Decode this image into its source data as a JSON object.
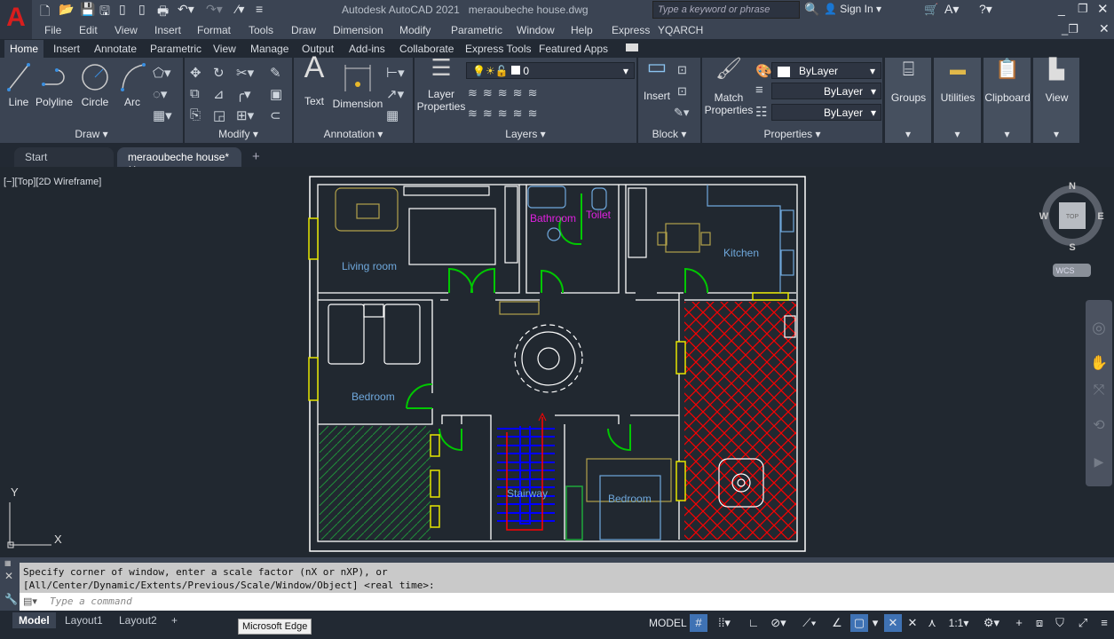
{
  "app": {
    "logo": "A",
    "title": "Autodesk AutoCAD 2021",
    "file": "meraoubeche house.dwg",
    "search_placeholder": "Type a keyword or phrase",
    "sign_in": "Sign In"
  },
  "menu": [
    "File",
    "Edit",
    "View",
    "Insert",
    "Format",
    "Tools",
    "Draw",
    "Dimension",
    "Modify",
    "Parametric",
    "Window",
    "Help",
    "Express",
    "YQARCH"
  ],
  "ribbon_tabs": [
    "Home",
    "Insert",
    "Annotate",
    "Parametric",
    "View",
    "Manage",
    "Output",
    "Add-ins",
    "Collaborate",
    "Express Tools",
    "Featured Apps"
  ],
  "panels": {
    "draw": {
      "title": "Draw",
      "tools": [
        "Line",
        "Polyline",
        "Circle",
        "Arc"
      ]
    },
    "modify": {
      "title": "Modify"
    },
    "annotation": {
      "title": "Annotation",
      "tools": [
        "Text",
        "Dimension"
      ]
    },
    "layers": {
      "title": "Layers",
      "tool": "Layer Properties",
      "current_layer": "0"
    },
    "block": {
      "title": "Block",
      "tool": "Insert"
    },
    "properties": {
      "title": "Properties",
      "tool": "Match Properties",
      "color": "ByLayer",
      "lineweight": "ByLayer",
      "linetype": "ByLayer"
    },
    "groups": "Groups",
    "utilities": "Utilities",
    "clipboard": "Clipboard",
    "view": "View"
  },
  "doc_tabs": [
    "Start",
    "meraoubeche house*"
  ],
  "viewport_label": "[−][Top][2D Wireframe]",
  "viewcube": {
    "n": "N",
    "s": "S",
    "e": "E",
    "w": "W",
    "face": "TOP",
    "ucs": "WCS"
  },
  "ucs_axes": {
    "x": "X",
    "y": "Y"
  },
  "rooms": {
    "living": "Living room",
    "bathroom": "Bathroom",
    "toilet": "Toilet",
    "kitchen": "Kitchen",
    "bedroom1": "Bedroom",
    "stairway": "Stairway",
    "bedroom2": "Bedroom"
  },
  "colors": {
    "wall": "#ffffff",
    "door": "#00c800",
    "window": "#e6e600",
    "label": "#6fa8dc",
    "bath_label": "#e020e0",
    "hatch_red": "#ff0000",
    "stairs": "#0000ff",
    "accent": "#3f72b4"
  },
  "command": {
    "line1": "Specify corner of window, enter a scale factor (nX or nXP), or",
    "line2": "[All/Center/Dynamic/Extents/Previous/Scale/Window/Object] <real time>:",
    "placeholder": "Type a command"
  },
  "layout_tabs": [
    "Model",
    "Layout1",
    "Layout2"
  ],
  "status": {
    "model": "MODEL",
    "scale": "1:1"
  },
  "tooltip": "Microsoft Edge"
}
